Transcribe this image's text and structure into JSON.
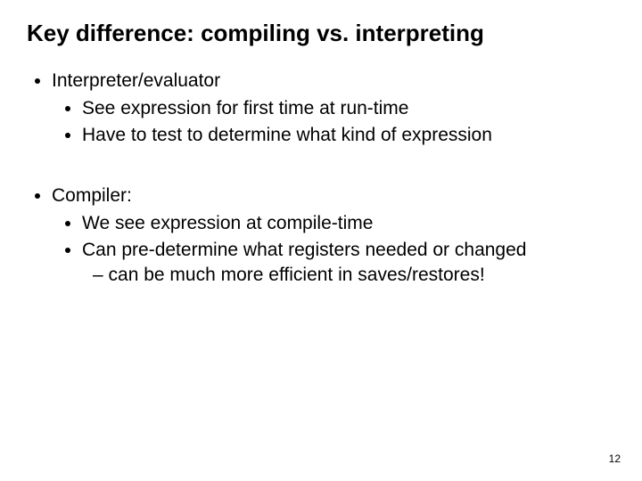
{
  "title": "Key difference: compiling vs. interpreting",
  "sec1": {
    "h": "Interpreter/evaluator",
    "p1": "See expression for first time at run-time",
    "p2": "Have to test to determine what kind of expression"
  },
  "sec2": {
    "h": "Compiler:",
    "p1": "We see expression at compile-time",
    "p2": "Can pre-determine what registers needed or changed",
    "p2d": "– can be much more efficient in saves/restores!"
  },
  "page": "12"
}
